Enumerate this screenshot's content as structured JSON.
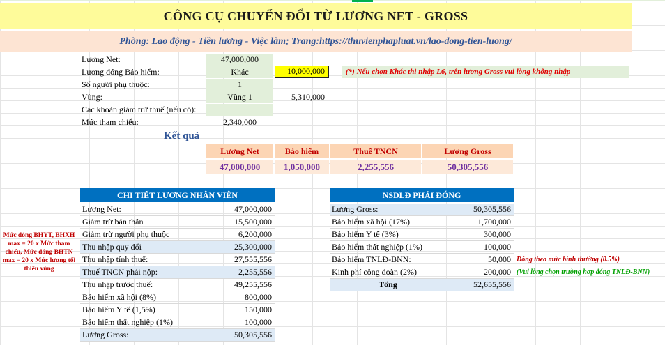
{
  "title": "CÔNG CỤ CHUYỂN ĐỔI TỪ LƯƠNG NET - GROSS",
  "subtitle": "Phòng: Lao động - Tiền lương - Việc làm; Trang:https://thuvienphapluat.vn/lao-dong-tien-luong/",
  "inputs": {
    "net_label": "Lương Net:",
    "net_value": "47,000,000",
    "insurance_label": "Lương đóng Bảo hiểm:",
    "insurance_option": "Khác",
    "insurance_amount": "10,000,000",
    "insurance_note": "(*) Nếu chọn Khác thì nhập L6, trên lương Gross vui lòng không nhập",
    "dependents_label": "Số người phụ thuộc:",
    "dependents_value": "1",
    "region_label": "Vùng:",
    "region_value": "Vùng 1",
    "region_wage": "5,310,000",
    "deductions_label": "Các khoản giảm trừ thuế (nếu có):",
    "deductions_value": "",
    "reference_label": "Mức tham chiếu:",
    "reference_value": "2,340,000"
  },
  "result": {
    "heading": "Kết quả",
    "headers": [
      "Lương Net",
      "Bảo hiểm",
      "Thuế TNCN",
      "Lương Gross"
    ],
    "values": [
      "47,000,000",
      "1,050,000",
      "2,255,556",
      "50,305,556"
    ]
  },
  "employee": {
    "heading": "CHI TIẾT LƯƠNG NHÂN VIÊN",
    "rows": [
      {
        "label": "Lương Net:",
        "value": "47,000,000"
      },
      {
        "label": "Giảm trừ bản thân",
        "value": "15,500,000"
      },
      {
        "label": "Giảm trừ người phụ thuộc",
        "value": "6,200,000"
      },
      {
        "label": "Thu nhập quy đổi",
        "value": "25,300,000"
      },
      {
        "label": "Thu nhập tính thuế:",
        "value": "27,555,556"
      },
      {
        "label": "Thuế TNCN phải nộp:",
        "value": "2,255,556"
      },
      {
        "label": "Thu nhập trước thuế:",
        "value": "49,255,556"
      },
      {
        "label": "Bảo hiểm xã hội (8%)",
        "value": "800,000"
      },
      {
        "label": "Bảo hiểm Y tế (1,5%)",
        "value": "150,000"
      },
      {
        "label": "Bảo hiểm thất nghiệp (1%)",
        "value": "100,000"
      },
      {
        "label": "Lương Gross:",
        "value": "50,305,556"
      }
    ]
  },
  "employer": {
    "heading": "NSDLĐ PHẢI ĐÓNG",
    "rows": [
      {
        "label": "Lương Gross:",
        "value": "50,305,556"
      },
      {
        "label": "Bảo hiểm xã hội (17%)",
        "value": "1,700,000"
      },
      {
        "label": "Bảo hiểm Y tế (3%)",
        "value": "300,000"
      },
      {
        "label": "Bảo hiểm thất nghiệp (1%)",
        "value": "100,000"
      },
      {
        "label": "Bảo hiểm TNLĐ-BNN:",
        "value": "50,000"
      },
      {
        "label": "Kinh phí công đoàn (2%)",
        "value": "200,000"
      },
      {
        "label": "Tổng",
        "value": "52,655,556"
      }
    ],
    "note_red": "Đóng theo mức bình thường (0.5%)",
    "note_green": "(Vui lòng chọn trường hợp đóng TNLĐ-BNN)"
  },
  "left_note": "Mức đóng BHYT, BHXH max = 20 x Mức tham chiếu, Mức đóng BHTN max = 20 x Mức lương tối thiểu vùng"
}
